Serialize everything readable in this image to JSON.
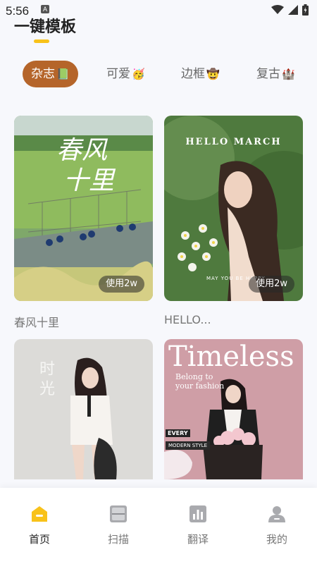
{
  "status": {
    "time": "5:56",
    "a_badge": "A"
  },
  "header": {
    "title": "一键模板"
  },
  "tabs": [
    {
      "label": "杂志",
      "emoji": "📗"
    },
    {
      "label": "可爱",
      "emoji": "🥳"
    },
    {
      "label": "边框",
      "emoji": "🤠"
    },
    {
      "label": "复古",
      "emoji": "🏰"
    }
  ],
  "templates": [
    {
      "title": "春风十里",
      "use_label": "使用2w",
      "overlay_title": "春风",
      "overlay_sub": "十里"
    },
    {
      "title": "HELLO...",
      "use_label": "使用2w",
      "overlay_title": "HELLO MARCH",
      "overlay_sub": "MAY YOU BE HAPPY"
    },
    {
      "title": "",
      "use_label": "",
      "overlay_title": "时光",
      "overlay_sub": ""
    },
    {
      "title": "",
      "use_label": "",
      "overlay_title": "Timeless",
      "overlay_sub": "Belong to your fashion",
      "overlay_every": "EVERY",
      "overlay_style": "MODERN STYLE"
    }
  ],
  "bottom_nav": [
    {
      "label": "首页",
      "active": true
    },
    {
      "label": "扫描",
      "active": false
    },
    {
      "label": "翻译",
      "active": false
    },
    {
      "label": "我的",
      "active": false
    }
  ],
  "colors": {
    "accent": "#f8c21a",
    "active_tab": "#b5652a",
    "background": "#f7f8fc"
  }
}
